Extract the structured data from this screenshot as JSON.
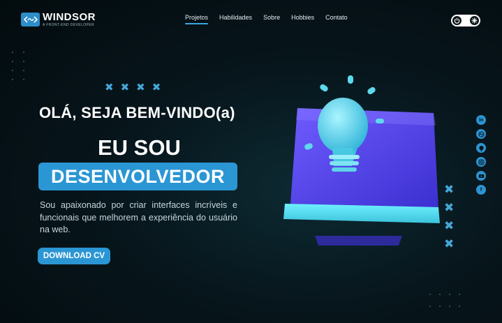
{
  "header": {
    "logo_name": "WINDSOR",
    "logo_tagline": "A FRONT-END DEVELOPER",
    "nav": [
      {
        "label": "Projetos",
        "active": true
      },
      {
        "label": "Habilidades",
        "active": false
      },
      {
        "label": "Sobre",
        "active": false
      },
      {
        "label": "Hobbies",
        "active": false
      },
      {
        "label": "Contato",
        "active": false
      }
    ],
    "theme_toggle": {
      "left_icon": "power-icon",
      "right_icon": "snowflake-icon"
    }
  },
  "hero": {
    "greeting": "OLÁ, SEJA BEM-VINDO(a)",
    "intro": "EU SOU",
    "role": "DESENVOLVEDOR",
    "description": "Sou apaixonado por criar interfaces incríveis e funcionais que melhorem a experiência do usuário na web.",
    "cta_label": "DOWNLOAD CV",
    "decor_x": "✖"
  },
  "social": [
    "linkedin-icon",
    "dribbble-icon",
    "github-icon",
    "instagram-icon",
    "youtube-icon",
    "facebook-icon"
  ],
  "colors": {
    "accent": "#2b96d4",
    "background": "#06141a",
    "illustration_monitor": "#5b47f0",
    "illustration_bulb": "#4fd1e6"
  }
}
